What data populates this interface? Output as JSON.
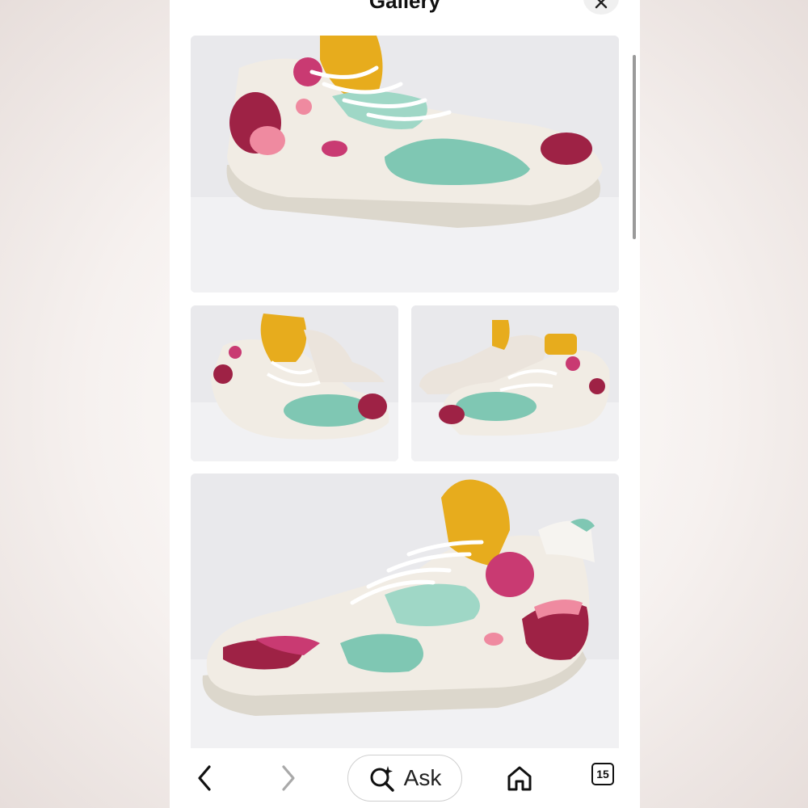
{
  "header": {
    "title": "Gallery"
  },
  "gallery": {
    "images": [
      {
        "name": "sneaker-side-view"
      },
      {
        "name": "sneaker-pair-front-left"
      },
      {
        "name": "sneaker-pair-front-right"
      },
      {
        "name": "sneaker-medial-side-view"
      }
    ]
  },
  "bottom_bar": {
    "back_icon": "chevron-left-icon",
    "forward_icon": "chevron-right-icon",
    "ask_label": "Ask",
    "ask_icon": "sparkle-search-icon",
    "home_icon": "home-icon",
    "tabs_count": "15"
  },
  "colors": {
    "shoe_white": "#f1ece4",
    "mint": "#8ccfbd",
    "magenta": "#c93a72",
    "burgundy": "#9e2245",
    "yellow": "#e7ac1d",
    "pink": "#ef8aa0"
  }
}
